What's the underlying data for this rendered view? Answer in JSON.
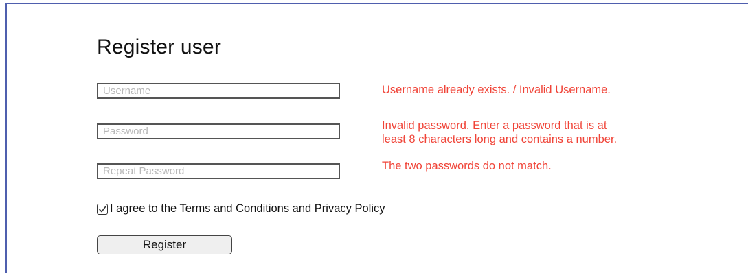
{
  "form": {
    "title": "Register user",
    "username": {
      "value": "",
      "placeholder": "Username",
      "error": "Username already exists. / Invalid Username."
    },
    "password": {
      "value": "",
      "placeholder": "Password",
      "error_line1": "Invalid password. Enter a password that is at",
      "error_line2": "least 8 characters long and contains a number."
    },
    "repeat_password": {
      "value": "",
      "placeholder": "Repeat Password",
      "error": "The two passwords do not match."
    },
    "agree": {
      "checked": true,
      "label": "I agree to the Terms and Conditions and Privacy Policy",
      "icon": "checkmark-icon"
    },
    "submit_label": "Register"
  },
  "colors": {
    "frame": "#4f5fae",
    "error": "#f04438",
    "text": "#111111",
    "placeholder": "#b8b8b8"
  }
}
